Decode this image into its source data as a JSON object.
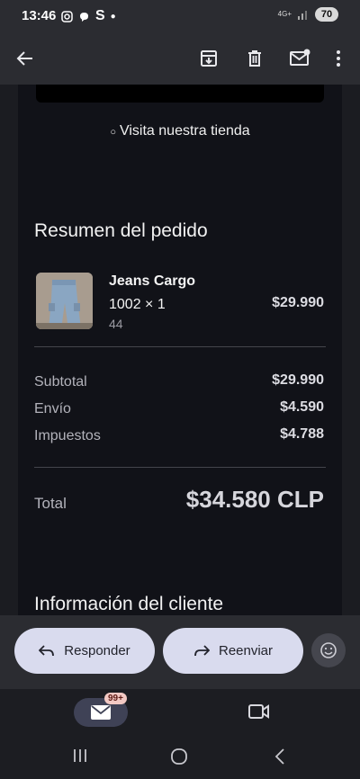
{
  "status_bar": {
    "time": "13:46",
    "left_icons": [
      "instagram-icon",
      "threads-icon",
      "s-icon",
      "dot-icon"
    ],
    "network_label": "4G+",
    "battery": "70"
  },
  "app_bar": {
    "icons": [
      "back-arrow-icon",
      "archive-icon",
      "delete-icon",
      "mark-unread-icon",
      "more-vert-icon"
    ]
  },
  "email": {
    "store_link": "Visita nuestra tienda",
    "order_summary_title": "Resumen del pedido",
    "item": {
      "name": "Jeans Cargo",
      "quantity": "1002 × 1",
      "variant": "44",
      "price": "$29.990"
    },
    "subtotal_label": "Subtotal",
    "subtotal_value": "$29.990",
    "shipping_label": "Envío",
    "shipping_value": "$4.590",
    "taxes_label": "Impuestos",
    "taxes_value": "$4.788",
    "total_label": "Total",
    "total_value": "$34.580 CLP",
    "customer_info_title": "Información del cliente"
  },
  "actions": {
    "reply_label": "Responder",
    "forward_label": "Reenviar"
  },
  "bottom_nav": {
    "mail_badge": "99+"
  },
  "colors": {
    "accent_pill": "#d9dbee",
    "email_bg": "#111218",
    "bar_bg": "#2b2c31"
  }
}
